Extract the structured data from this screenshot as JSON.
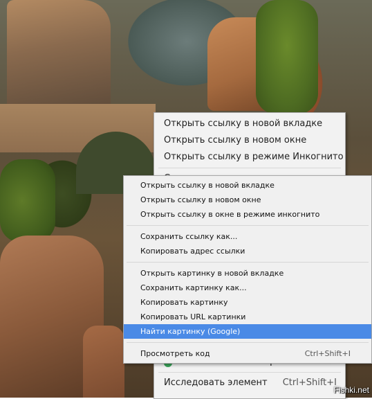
{
  "back_menu": {
    "items": [
      {
        "label": "Открыть ссылку в новой вкладке"
      },
      {
        "label": "Открыть ссылку в новом окне"
      },
      {
        "label": "Открыть ссылку в режиме Инкогнито"
      },
      {
        "label": "Сохранить ссылку как..."
      }
    ],
    "adguard_label": "AdGuard Антибаннер",
    "inspect_label": "Исследовать элемент",
    "inspect_shortcut": "Ctrl+Shift+I"
  },
  "context_menu": {
    "group1": [
      {
        "label": "Открыть ссылку в новой вкладке"
      },
      {
        "label": "Открыть ссылку в новом окне"
      },
      {
        "label": "Открыть ссылку в окне в режиме инкогнито"
      }
    ],
    "group2": [
      {
        "label": "Сохранить ссылку как..."
      },
      {
        "label": "Копировать адрес ссылки"
      }
    ],
    "group3": [
      {
        "label": "Открыть картинку в новой вкладке"
      },
      {
        "label": "Сохранить картинку как..."
      },
      {
        "label": "Копировать картинку"
      },
      {
        "label": "Копировать URL картинки"
      },
      {
        "label": "Найти картинку (Google)"
      }
    ],
    "view_source_label": "Просмотреть код",
    "view_source_shortcut": "Ctrl+Shift+I"
  },
  "watermark": "Fishki.net"
}
